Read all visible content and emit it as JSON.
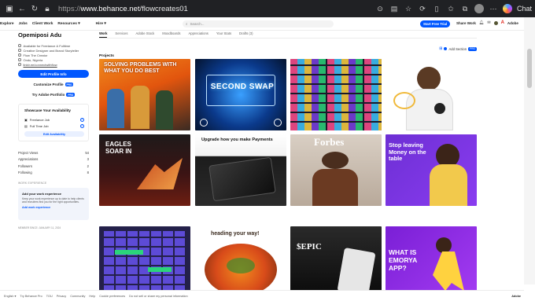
{
  "browser": {
    "url_proto": "https://",
    "url_host": "www.behance.net",
    "url_path": "/flowcreates01",
    "chat_label": "Chat"
  },
  "topnav": {
    "links": [
      "Explore",
      "Jobs",
      "Client Work",
      "Resources ▾",
      "Hire ▾"
    ],
    "search_placeholder": "Search...",
    "free_trial": "Start Free Trial",
    "share_work": "Share Work",
    "adobe_label": "Adobe"
  },
  "profile": {
    "name": "Opemiposi Adu",
    "info": [
      "Available for Freelance & Fulltime",
      "Creative Designer and Brand Storyteller",
      "Flow The Creator",
      "Ondo, Nigeria",
      "linktr.ee/connectwithflow"
    ],
    "edit_profile": "Edit Profile Info",
    "customize_profile": "Customize Profile",
    "try_portfolio": "Try Adobe Portfolio",
    "pro_badge": "PRO"
  },
  "availability": {
    "title": "Showcase Your Availability",
    "options": [
      "Freelance Job",
      "Full Time Job"
    ],
    "edit": "Edit Availability"
  },
  "stats": [
    {
      "label": "Project Views",
      "value": "54"
    },
    {
      "label": "Appreciations",
      "value": "3"
    },
    {
      "label": "Followers",
      "value": "2"
    },
    {
      "label": "Following",
      "value": "8"
    }
  ],
  "work_experience": {
    "section_label": "WORK EXPERIENCE",
    "title": "Add your work experience",
    "body": "Keep your work experience up to date to help clients and recruiters find you for the right opportunities.",
    "link": "Add work experience"
  },
  "member_since": "MEMBER SINCE: JANUARY 11, 2024",
  "tabs": [
    "Work",
    "Services",
    "Adobe Stock",
    "Moodboards",
    "Appreciations",
    "Your Stats",
    "Drafts (3)"
  ],
  "projects_label": "Projects",
  "add_section": "Add Section",
  "tiles": {
    "t1": "SOLVING PROBLEMS WITH WHAT YOU DO BEST",
    "t2": "SECOND SWAP",
    "t5": "EAGLES SOAR IN",
    "t6": "Upgrade how you make Payments",
    "t7": "Forbes",
    "t8": "Stop leaving Money on the table",
    "t10": "heading your way!",
    "t11": "$EPIC",
    "t12": "WHAT IS EMORYA APP?"
  },
  "footer": {
    "items": [
      "English ▾",
      "Try Behance Pro",
      "TOU",
      "Privacy",
      "Community",
      "Help",
      "Cookie preferences",
      "Do not sell or share my personal information"
    ],
    "adobe": "Adobe"
  }
}
